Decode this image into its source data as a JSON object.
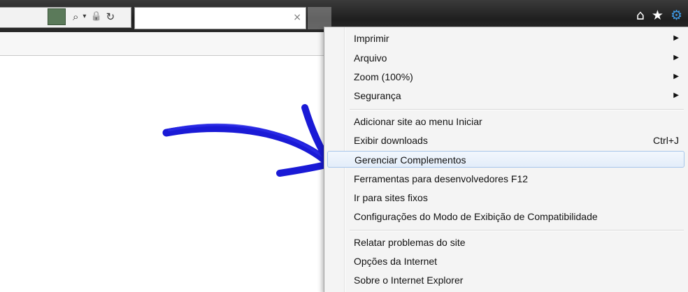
{
  "toolbar": {
    "address_tools": [
      "⌕",
      "▾",
      "🔒",
      "↻"
    ],
    "tab_close": "×",
    "icons": [
      "home-icon",
      "favorites-star-icon",
      "tools-gear-icon"
    ],
    "accent_color": "#3f9be8"
  },
  "menu": {
    "items": [
      {
        "label": "Imprimir",
        "submenu": true
      },
      {
        "label": "Arquivo",
        "submenu": true
      },
      {
        "label": "Zoom (100%)",
        "submenu": true
      },
      {
        "label": "Segurança",
        "submenu": true
      },
      {
        "label": "Adicionar site ao menu Iniciar"
      },
      {
        "label": "Exibir downloads",
        "shortcut": "Ctrl+J"
      },
      {
        "label": "Gerenciar Complementos",
        "highlighted": true
      },
      {
        "label": "Ferramentas para desenvolvedores F12"
      },
      {
        "label": "Ir para sites fixos"
      },
      {
        "label": "Configurações do Modo de Exibição de Compatibilidade"
      },
      {
        "label": "Relatar problemas do site"
      },
      {
        "label": "Opções da Internet"
      },
      {
        "label": "Sobre o Internet Explorer"
      }
    ],
    "submenu_arrow": "▶"
  },
  "annotation": {
    "arrow_color": "#1a1ad6"
  }
}
